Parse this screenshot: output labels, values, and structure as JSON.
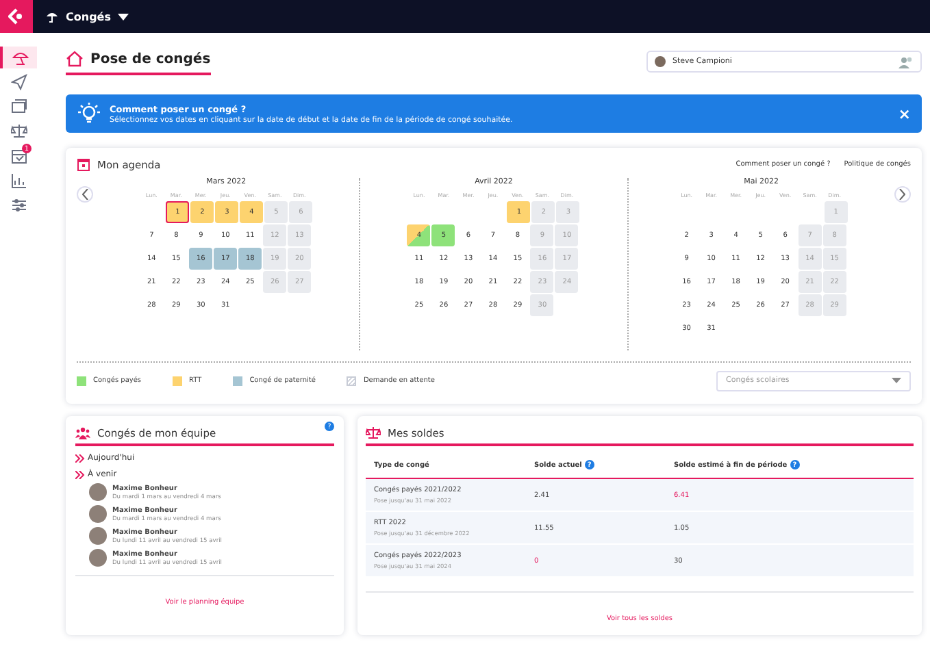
{
  "topbar": {
    "app": "Congés"
  },
  "sidebar": {
    "items": [
      {
        "selected": true
      },
      {
        "selected": false
      },
      {
        "selected": false
      },
      {
        "selected": false
      },
      {
        "selected": false,
        "badge": "1"
      },
      {
        "selected": false
      },
      {
        "selected": false
      }
    ]
  },
  "page": {
    "title": "Pose de congés",
    "user": "Steve Campioni"
  },
  "banner": {
    "title": "Comment poser un congé ?",
    "text": "Sélectionnez vos dates en cliquant sur la date de début et la date de fin de la période de congé souhaitée.",
    "close": "×"
  },
  "agenda": {
    "title": "Mon agenda",
    "links": [
      "Comment poser un congé ?",
      "Politique de congés"
    ],
    "months": [
      {
        "title": "Mars 2022",
        "weekdays": [
          "Lun.",
          "Mar.",
          "Mer.",
          "Jeu.",
          "Ven.",
          "Sam.",
          "Dim."
        ],
        "weeks": [
          [
            {
              "n": "1",
              "kind": "rtt",
              "selected": true
            },
            {
              "n": "2",
              "kind": "rtt",
              "selected": false
            },
            {
              "n": "3",
              "kind": "rtt",
              "selected": false
            },
            {
              "n": "4",
              "kind": "rtt",
              "selected": false
            },
            {
              "n": "5",
              "kind": "weekend",
              "selected": false
            },
            {
              "n": "6",
              "kind": "weekend",
              "selected": false
            }
          ],
          [
            {
              "n": "7",
              "kind": "work",
              "selected": false
            },
            {
              "n": "8",
              "kind": "work",
              "selected": false
            },
            {
              "n": "9",
              "kind": "work",
              "selected": false
            },
            {
              "n": "10",
              "kind": "work",
              "selected": false
            },
            {
              "n": "11",
              "kind": "work",
              "selected": false
            },
            {
              "n": "12",
              "kind": "weekend",
              "selected": false
            },
            {
              "n": "13",
              "kind": "weekend",
              "selected": false
            }
          ],
          [
            {
              "n": "14",
              "kind": "work",
              "selected": false
            },
            {
              "n": "15",
              "kind": "work",
              "selected": false
            },
            {
              "n": "16",
              "kind": "paternity",
              "selected": false
            },
            {
              "n": "17",
              "kind": "paternity",
              "selected": false
            },
            {
              "n": "18",
              "kind": "paternity",
              "selected": false
            },
            {
              "n": "19",
              "kind": "weekend",
              "selected": false
            },
            {
              "n": "20",
              "kind": "weekend",
              "selected": false
            }
          ],
          [
            {
              "n": "21",
              "kind": "work",
              "selected": false
            },
            {
              "n": "22",
              "kind": "work",
              "selected": false
            },
            {
              "n": "23",
              "kind": "work",
              "selected": false
            },
            {
              "n": "24",
              "kind": "work",
              "selected": false
            },
            {
              "n": "25",
              "kind": "work",
              "selected": false
            },
            {
              "n": "26",
              "kind": "weekend",
              "selected": false
            },
            {
              "n": "27",
              "kind": "weekend",
              "selected": false
            }
          ],
          [
            {
              "n": "28",
              "kind": "work",
              "selected": false
            },
            {
              "n": "29",
              "kind": "work",
              "selected": false
            },
            {
              "n": "30",
              "kind": "work",
              "selected": false
            },
            {
              "n": "31",
              "kind": "work",
              "selected": false
            }
          ]
        ]
      },
      {
        "title": "Avril 2022",
        "weekdays": [
          "Lun.",
          "Mar.",
          "Mer.",
          "Jeu.",
          "Ven.",
          "Sam.",
          "Dim."
        ],
        "weeks": [
          [
            {
              "n": "1",
              "kind": "rtt",
              "selected": false
            },
            {
              "n": "2",
              "kind": "weekend",
              "selected": false
            },
            {
              "n": "3",
              "kind": "weekend",
              "selected": false
            }
          ],
          [
            {
              "n": "4",
              "kind": "rtt-paid",
              "selected": false
            },
            {
              "n": "5",
              "kind": "paid",
              "selected": false
            },
            {
              "n": "6",
              "kind": "work",
              "selected": false
            },
            {
              "n": "7",
              "kind": "work",
              "selected": false
            },
            {
              "n": "8",
              "kind": "work",
              "selected": false
            },
            {
              "n": "9",
              "kind": "weekend",
              "selected": false
            },
            {
              "n": "10",
              "kind": "weekend",
              "selected": false
            }
          ],
          [
            {
              "n": "11",
              "kind": "work",
              "selected": false
            },
            {
              "n": "12",
              "kind": "work",
              "selected": false
            },
            {
              "n": "13",
              "kind": "work",
              "selected": false
            },
            {
              "n": "14",
              "kind": "work",
              "selected": false
            },
            {
              "n": "15",
              "kind": "work",
              "selected": false
            },
            {
              "n": "16",
              "kind": "weekend",
              "selected": false
            },
            {
              "n": "17",
              "kind": "weekend",
              "selected": false
            }
          ],
          [
            {
              "n": "18",
              "kind": "work",
              "selected": false
            },
            {
              "n": "19",
              "kind": "work",
              "selected": false
            },
            {
              "n": "20",
              "kind": "work",
              "selected": false
            },
            {
              "n": "21",
              "kind": "work",
              "selected": false
            },
            {
              "n": "22",
              "kind": "work",
              "selected": false
            },
            {
              "n": "23",
              "kind": "weekend",
              "selected": false
            },
            {
              "n": "24",
              "kind": "weekend",
              "selected": false
            }
          ],
          [
            {
              "n": "25",
              "kind": "work",
              "selected": false
            },
            {
              "n": "26",
              "kind": "work",
              "selected": false
            },
            {
              "n": "27",
              "kind": "work",
              "selected": false
            },
            {
              "n": "28",
              "kind": "work",
              "selected": false
            },
            {
              "n": "29",
              "kind": "work",
              "selected": false
            },
            {
              "n": "30",
              "kind": "weekend",
              "selected": false
            }
          ]
        ]
      },
      {
        "title": "Mai 2022",
        "weekdays": [
          "Lun.",
          "Mar.",
          "Mer.",
          "Jeu.",
          "Ven.",
          "Sam.",
          "Dim."
        ],
        "weeks": [
          [
            {
              "n": "1",
              "kind": "weekend",
              "selected": false
            }
          ],
          [
            {
              "n": "2",
              "kind": "work",
              "selected": false
            },
            {
              "n": "3",
              "kind": "work",
              "selected": false
            },
            {
              "n": "4",
              "kind": "work",
              "selected": false
            },
            {
              "n": "5",
              "kind": "work",
              "selected": false
            },
            {
              "n": "6",
              "kind": "work",
              "selected": false
            },
            {
              "n": "7",
              "kind": "weekend",
              "selected": false
            },
            {
              "n": "8",
              "kind": "weekend",
              "selected": false
            }
          ],
          [
            {
              "n": "9",
              "kind": "work",
              "selected": false
            },
            {
              "n": "10",
              "kind": "work",
              "selected": false
            },
            {
              "n": "11",
              "kind": "work",
              "selected": false
            },
            {
              "n": "12",
              "kind": "work",
              "selected": false
            },
            {
              "n": "13",
              "kind": "work",
              "selected": false
            },
            {
              "n": "14",
              "kind": "weekend",
              "selected": false
            },
            {
              "n": "15",
              "kind": "weekend",
              "selected": false
            }
          ],
          [
            {
              "n": "16",
              "kind": "work",
              "selected": false
            },
            {
              "n": "17",
              "kind": "work",
              "selected": false
            },
            {
              "n": "18",
              "kind": "work",
              "selected": false
            },
            {
              "n": "19",
              "kind": "work",
              "selected": false
            },
            {
              "n": "20",
              "kind": "work",
              "selected": false
            },
            {
              "n": "21",
              "kind": "weekend",
              "selected": false
            },
            {
              "n": "22",
              "kind": "weekend",
              "selected": false
            }
          ],
          [
            {
              "n": "23",
              "kind": "work",
              "selected": false
            },
            {
              "n": "24",
              "kind": "work",
              "selected": false
            },
            {
              "n": "25",
              "kind": "work",
              "selected": false
            },
            {
              "n": "26",
              "kind": "work",
              "selected": false
            },
            {
              "n": "27",
              "kind": "work",
              "selected": false
            },
            {
              "n": "28",
              "kind": "weekend",
              "selected": false
            },
            {
              "n": "29",
              "kind": "weekend",
              "selected": false
            }
          ],
          [
            {
              "n": "30",
              "kind": "work",
              "selected": false
            },
            {
              "n": "31",
              "kind": "work",
              "selected": false
            }
          ]
        ]
      }
    ],
    "legend": [
      {
        "label": "Congés payés",
        "kind": "solid",
        "color": "#8ee27a"
      },
      {
        "label": "RTT",
        "kind": "solid",
        "color": "#fdd36f"
      },
      {
        "label": "Congé de paternité",
        "kind": "solid",
        "color": "#a5c5d3"
      },
      {
        "label": "Demande en attente",
        "kind": "hatched",
        "color": "#c8ccd6"
      }
    ],
    "filter": {
      "placeholder": "Congés scolaires"
    }
  },
  "team": {
    "title": "Congés de mon équipe",
    "help": "?",
    "today": "Aujourd'hui",
    "upcoming": "À venir",
    "people": [
      {
        "name": "Maxime Bonheur",
        "dates": "Du mardi 1 mars au vendredi 4 mars"
      },
      {
        "name": "Maxime Bonheur",
        "dates": "Du mardi 1 mars au vendredi 4 mars"
      },
      {
        "name": "Maxime Bonheur",
        "dates": "Du lundi 11 avril au vendredi 15 avril"
      },
      {
        "name": "Maxime Bonheur",
        "dates": "Du lundi 11 avril au vendredi 15 avril"
      }
    ],
    "link": "Voir le planning équipe"
  },
  "balances": {
    "title": "Mes soldes",
    "columns": [
      {
        "label": "Type de congé"
      },
      {
        "label": "Solde actuel",
        "help": "?"
      },
      {
        "label": "Solde estimé à fin de période",
        "help": "?"
      }
    ],
    "rows": [
      {
        "type": "Congés payés 2021/2022",
        "note": "Pose jusqu'au 31 mai 2022",
        "current": {
          "value": "2.41",
          "alert": false
        },
        "estimated": {
          "value": "6.41",
          "alert": true
        }
      },
      {
        "type": "RTT 2022",
        "note": "Pose jusqu'au 31 décembre 2022",
        "current": {
          "value": "11.55",
          "alert": false
        },
        "estimated": {
          "value": "1.05",
          "alert": false
        }
      },
      {
        "type": "Congés payés 2022/2023",
        "note": "Pose jusqu'au 31 mai 2024",
        "current": {
          "value": "0",
          "alert": true
        },
        "estimated": {
          "value": "30",
          "alert": false
        }
      }
    ],
    "link": "Voir tous les soldes"
  }
}
